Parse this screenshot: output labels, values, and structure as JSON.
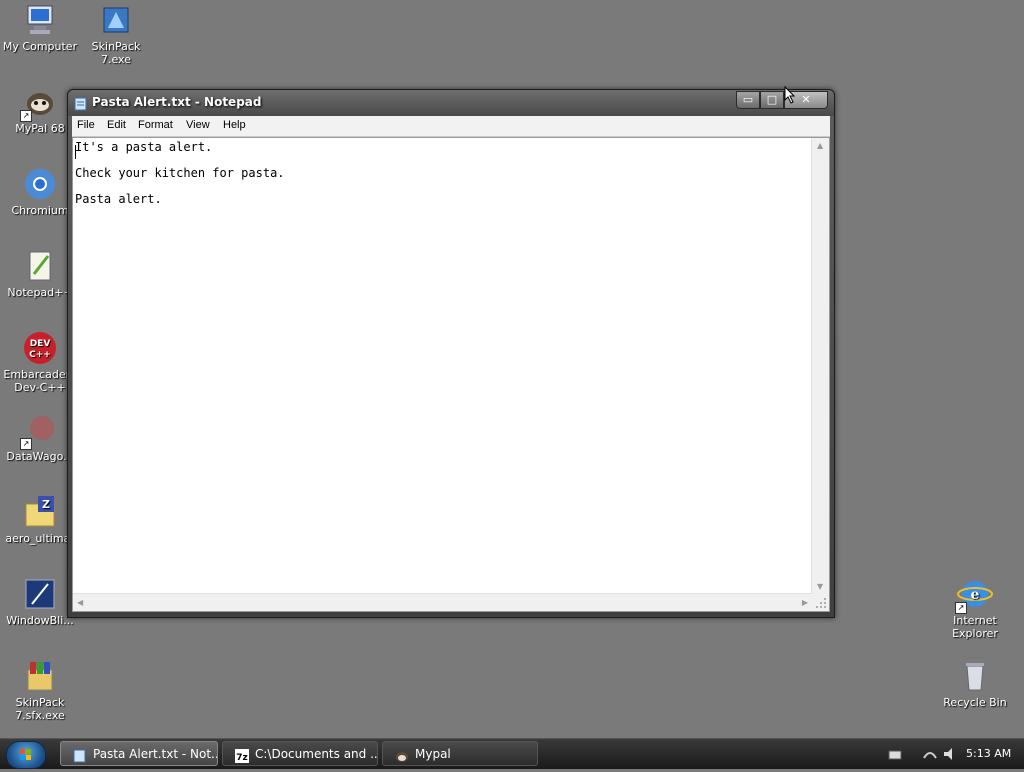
{
  "desktop": {
    "icons_left": [
      {
        "label": "My Computer"
      },
      {
        "label": "SkinPack 7.exe"
      },
      {
        "label": "MyPal 68"
      },
      {
        "label": "Chromium"
      },
      {
        "label": "Notepad++"
      },
      {
        "label": "Embarcadero Dev-C++"
      },
      {
        "label": "DataWago..."
      },
      {
        "label": "aero_ultimat"
      },
      {
        "label": "WindowBli..."
      },
      {
        "label": "SkinPack 7.sfx.exe"
      }
    ],
    "icons_right": [
      {
        "label": "Internet Explorer"
      },
      {
        "label": "Recycle Bin"
      }
    ]
  },
  "window": {
    "title": "Pasta Alert.txt - Notepad",
    "min_symbol": "▭",
    "max_symbol": "□",
    "close_symbol": "✕",
    "menu": [
      "File",
      "Edit",
      "Format",
      "View",
      "Help"
    ],
    "lines": [
      "It's a pasta alert.",
      "Check your kitchen for pasta.",
      "Pasta alert."
    ]
  },
  "taskbar": {
    "items": [
      {
        "label": "Pasta Alert.txt - Not..."
      },
      {
        "label": "C:\\Documents and ..."
      },
      {
        "label": "Mypal"
      }
    ],
    "clock": "5:13 AM"
  },
  "colors": {
    "desktop_bg": "#7a7a7a",
    "window_frame": "#4a4a4a",
    "taskbar_bg": "#1a1a1a"
  },
  "icons": [
    "notepad-icon",
    "chromium-icon",
    "recycle-bin-icon",
    "ie-icon",
    "start-orb-icon"
  ]
}
